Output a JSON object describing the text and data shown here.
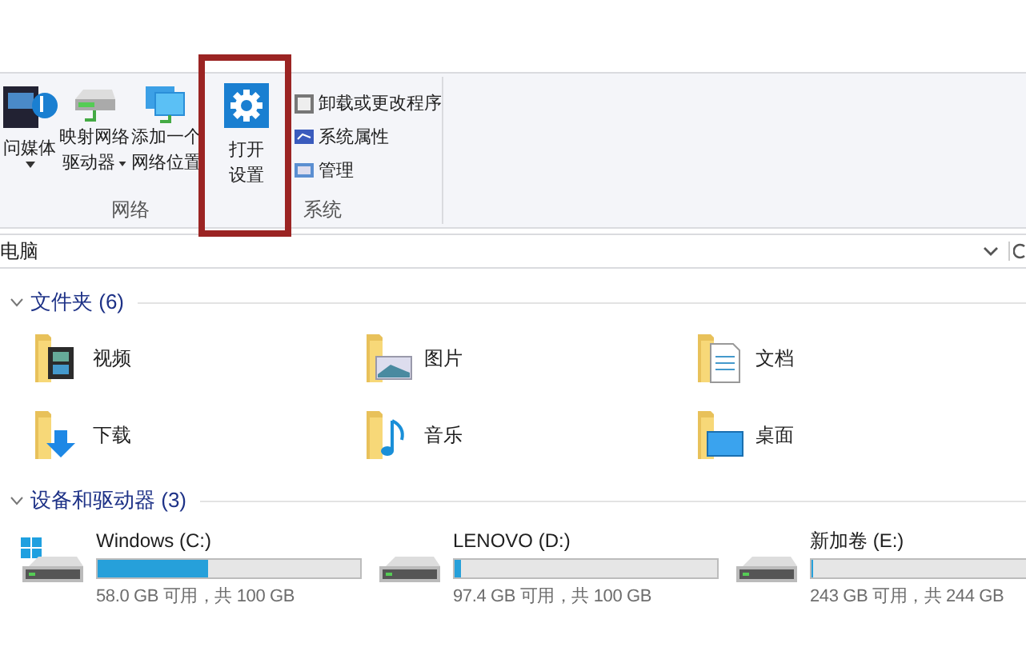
{
  "ribbon": {
    "media_button": {
      "label": "问媒体"
    },
    "network_group": {
      "label": "网络",
      "buttons": [
        {
          "line1": "映射网络",
          "line2": "驱动器",
          "dropdown": true
        },
        {
          "line1": "添加一个",
          "line2": "网络位置",
          "dropdown": false
        }
      ]
    },
    "settings_button": {
      "line1": "打开",
      "line2": "设置",
      "highlighted": true
    },
    "system_group": {
      "label": "系统",
      "items": [
        "卸载或更改程序",
        "系统属性",
        "管理"
      ]
    }
  },
  "address_bar": {
    "path": "电脑"
  },
  "folders": {
    "header": "文件夹 (6)",
    "expanded": true,
    "items": [
      {
        "name": "视频"
      },
      {
        "name": "图片"
      },
      {
        "name": "文档"
      },
      {
        "name": "下载"
      },
      {
        "name": "音乐"
      },
      {
        "name": "桌面"
      }
    ]
  },
  "drives": {
    "header": "设备和驱动器 (3)",
    "expanded": true,
    "items": [
      {
        "name": "Windows (C:)",
        "level": 0.42,
        "space": "58.0 GB 可用，共 100 GB",
        "system": true
      },
      {
        "name": "LENOVO (D:)",
        "level": 0.026,
        "space": "97.4 GB 可用，共 100 GB",
        "system": false
      },
      {
        "name": "新加卷 (E:)",
        "level": 0.006,
        "space": "243 GB 可用，共 244 GB",
        "system": false
      }
    ]
  }
}
